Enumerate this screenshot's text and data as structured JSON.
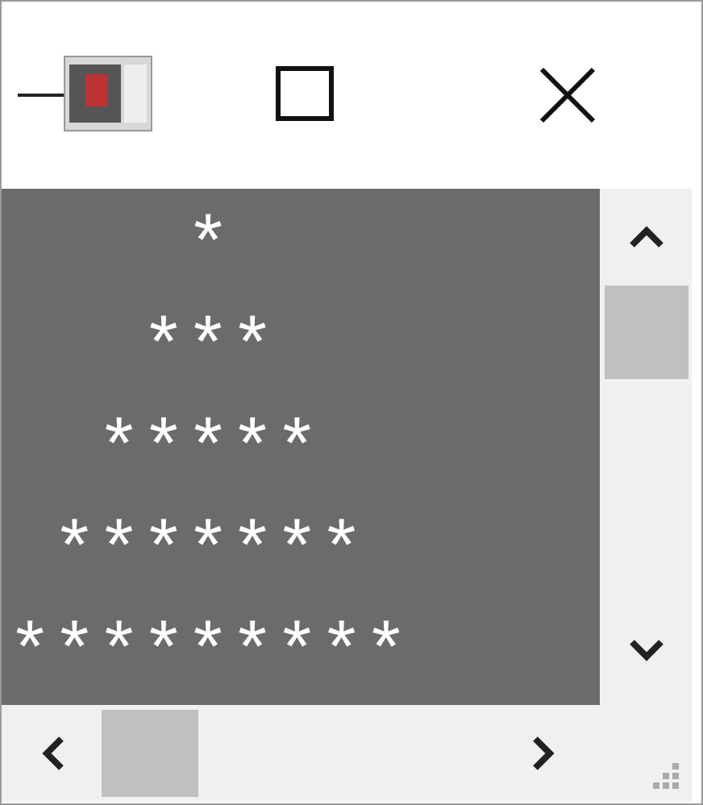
{
  "console": {
    "output": "*\n***\n*****\n*******\n*********"
  }
}
